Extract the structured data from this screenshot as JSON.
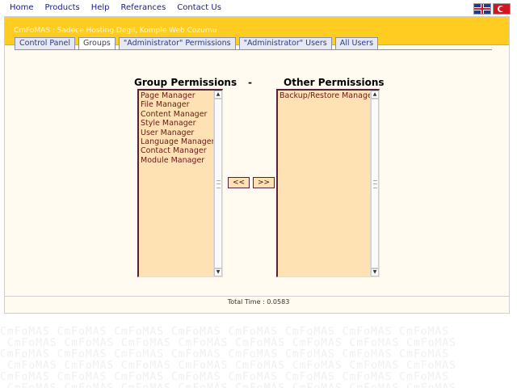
{
  "nav": {
    "links": [
      "Home",
      "Products",
      "Help",
      "Referances",
      "Contact Us"
    ]
  },
  "languages": [
    {
      "name": "English",
      "icon": "uk-flag-icon"
    },
    {
      "name": "Türkçe",
      "icon": "turkish-flag-icon"
    }
  ],
  "banner": {
    "text": "CmFoMAS : Sadece Hosting Degil, Komple Web Cozumu"
  },
  "tabs": [
    {
      "label": "Control Panel",
      "active": false
    },
    {
      "label": "Groups",
      "active": true
    },
    {
      "label": "\"Administrator\" Permissions",
      "active": false
    },
    {
      "label": "\"Administrator\" Users",
      "active": false
    },
    {
      "label": "All Users",
      "active": false
    }
  ],
  "permissions": {
    "group_title": "Group Permissions",
    "separator": "-",
    "other_title": "Other Permissions",
    "group_items": [
      "Page Manager",
      "File Manager",
      "Content Manager",
      "Style Manager",
      "User Manager",
      "Language Manager",
      "Contact Manager",
      "Module Manager"
    ],
    "other_items": [
      "Backup/Restore Manager"
    ],
    "move_left_label": "<<",
    "move_right_label": ">>"
  },
  "footer": {
    "total_time": "Total Time : 0.0583"
  },
  "colors": {
    "banner": "#ffcc22",
    "listbox": "#ffe2b3",
    "listbox_border": "#5a1f3a",
    "link": "#1a1a8a"
  }
}
